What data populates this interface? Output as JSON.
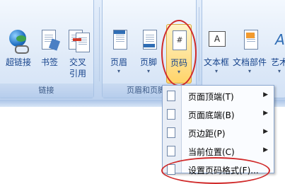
{
  "groups": {
    "links": {
      "label": "链接",
      "buttons": [
        "超链接",
        "书签",
        "交叉\n引用"
      ]
    },
    "header_footer": {
      "label": "页眉和页脚",
      "buttons": [
        "页眉",
        "页脚",
        "页码"
      ]
    },
    "text": {
      "buttons": [
        "文本框",
        "文档部件",
        "艺术"
      ]
    }
  },
  "page_number_icon_glyph": "#",
  "menu": {
    "items": [
      {
        "label": "页面顶端(T)",
        "submenu": true
      },
      {
        "label": "页面底端(B)",
        "submenu": true
      },
      {
        "label": "页边距(P)",
        "submenu": true
      },
      {
        "label": "当前位置(C)",
        "submenu": true
      },
      {
        "label": "设置页码格式(F)...",
        "submenu": false
      }
    ]
  },
  "colors": {
    "highlight": "#d02a2a",
    "ribbon": "#dfeaf8"
  }
}
